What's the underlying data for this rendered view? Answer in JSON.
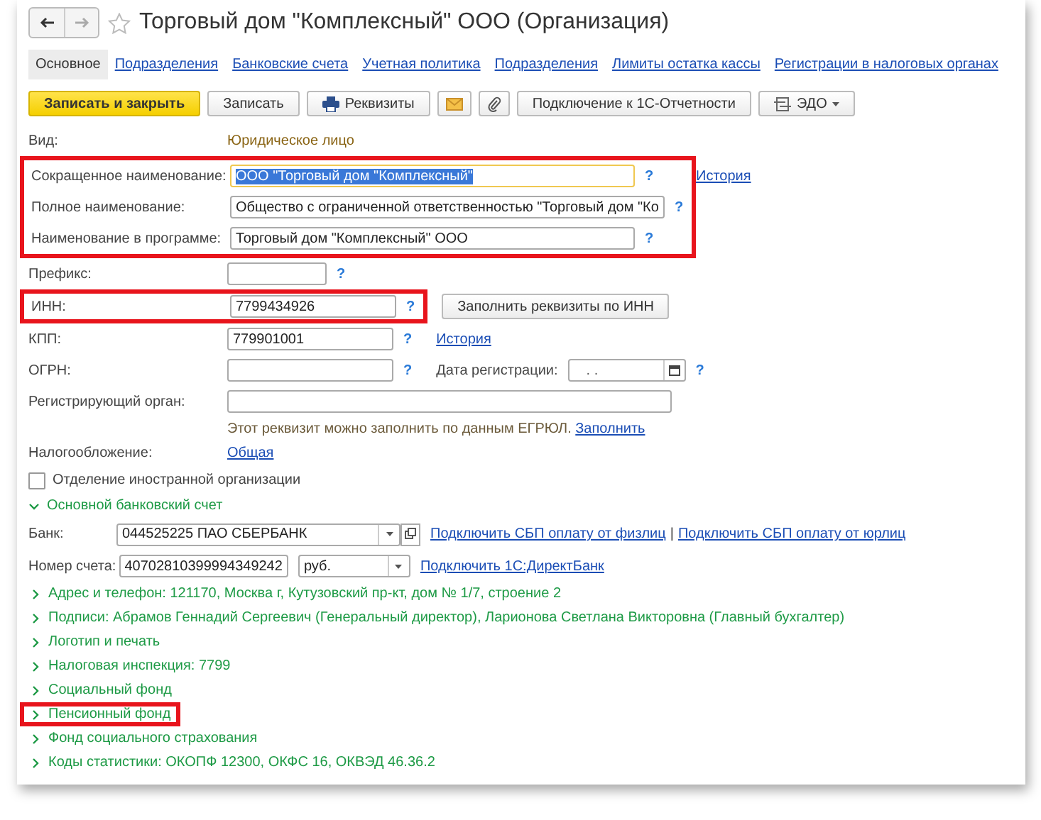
{
  "window": {
    "title": "Торговый дом \"Комплексный\" ООО (Организация)"
  },
  "tabs": [
    {
      "label": "Основное",
      "selected": true
    },
    {
      "label": "Подразделения",
      "selected": false
    },
    {
      "label": "Банковские счета",
      "selected": false
    },
    {
      "label": "Учетная политика",
      "selected": false
    },
    {
      "label": "Подразделения",
      "selected": false
    },
    {
      "label": "Лимиты остатка кассы",
      "selected": false
    },
    {
      "label": "Регистрации в налоговых органах",
      "selected": false
    }
  ],
  "toolbar": [
    {
      "kind": "primary",
      "label": "Записать и закрыть"
    },
    {
      "kind": "plain",
      "label": "Записать"
    },
    {
      "kind": "print",
      "label": "Реквизиты"
    },
    {
      "kind": "mail"
    },
    {
      "kind": "clip"
    },
    {
      "kind": "plain",
      "label": "Подключение к 1С-Отчетности"
    },
    {
      "kind": "menu",
      "label": "ЭДО"
    }
  ],
  "kind_row": {
    "label": "Вид:",
    "value": "Юридическое лицо"
  },
  "name_group": {
    "highlighted": true,
    "fields": [
      {
        "label": "Сокращенное наименование:",
        "value": "ООО \"Торговый дом \"Комплексный\"",
        "focused": true,
        "help": "?",
        "link": "История"
      },
      {
        "label": "Полное наименование:",
        "value": "Общество с ограниченной ответственностью \"Торговый дом \"Ко",
        "focused": false,
        "help": "?"
      },
      {
        "label": "Наименование в программе:",
        "value": "Торговый дом \"Комплексный\" ООО",
        "focused": false,
        "help": "?"
      }
    ]
  },
  "prefix": {
    "label": "Префикс:",
    "help": "?"
  },
  "inn": {
    "label": "ИНН:",
    "value": "7799434926",
    "help": "?",
    "highlighted": true,
    "button": "Заполнить реквизиты по ИНН"
  },
  "kpp": {
    "label": "КПП:",
    "value": "779901001",
    "help": "?",
    "link": "История"
  },
  "ogrn": {
    "label": "ОГРН:",
    "help": "?",
    "date_label": "Дата регистрации:",
    "date_placeholder": ".  .",
    "date_help": "?"
  },
  "registrar": {
    "label": "Регистрирующий орган:",
    "hint": "Этот реквизит можно заполнить по данным ЕГРЮЛ.",
    "hint_link": "Заполнить"
  },
  "taxation": {
    "label": "Налогообложение:",
    "link": "Общая"
  },
  "foreign_branch": {
    "label": "Отделение иностранной организации",
    "checked": false
  },
  "bank_section": {
    "title": "Основной банковский счет",
    "expanded": true,
    "bank_label": "Банк:",
    "bank_value": "044525225 ПАО СБЕРБАНК",
    "links": [
      "Подключить СБП оплату от физлиц",
      "Подключить СБП оплату от юрлиц"
    ],
    "separator": "|",
    "account_label": "Номер счета:",
    "account_value": "40702810399994349242",
    "currency": "руб.",
    "direct_link": "Подключить 1С:ДиректБанк"
  },
  "sections": [
    {
      "title": "Адрес и телефон: 121170, Москва г, Кутузовский пр-кт, дом № 1/7, строение 2",
      "expanded": false,
      "highlighted": false
    },
    {
      "title": "Подписи: Абрамов Геннадий Сергеевич (Генеральный директор), Ларионова Светлана Викторовна (Главный бухгалтер)",
      "expanded": false,
      "highlighted": false
    },
    {
      "title": "Логотип и печать",
      "expanded": false,
      "highlighted": false
    },
    {
      "title": "Налоговая инспекция: 7799",
      "expanded": false,
      "highlighted": false
    },
    {
      "title": "Социальный фонд",
      "expanded": false,
      "highlighted": false
    },
    {
      "title": "Пенсионный фонд",
      "expanded": false,
      "highlighted": true
    },
    {
      "title": "Фонд социального страхования",
      "expanded": false,
      "highlighted": false
    },
    {
      "title": "Коды статистики: ОКОПФ 12300, ОКФС 16, ОКВЭД 46.36.2",
      "expanded": false,
      "highlighted": false
    }
  ]
}
